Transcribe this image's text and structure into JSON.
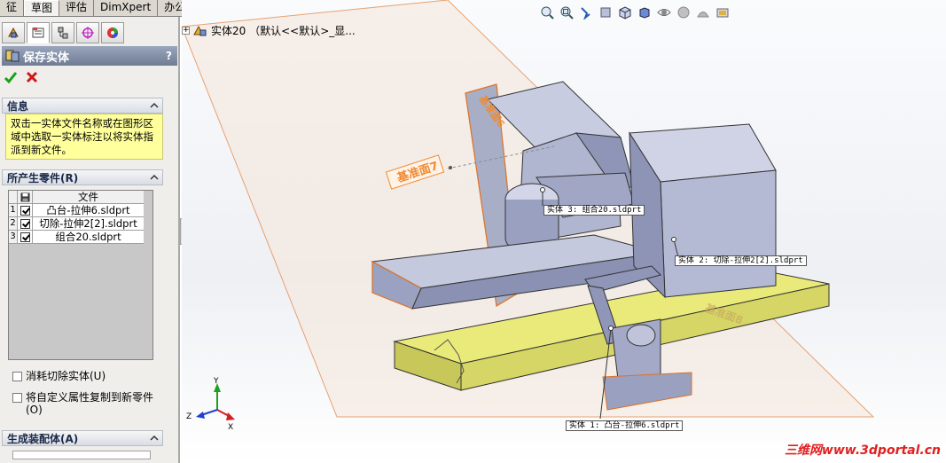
{
  "top_tabs": [
    "征",
    "草图",
    "评估",
    "DimXpert",
    "办公室产品"
  ],
  "active_top_tab": "草图",
  "manager_tabs": [
    "feature-manager-icon",
    "property-manager-icon",
    "configuration-manager-icon",
    "dimxpert-manager-icon",
    "display-manager-icon"
  ],
  "property_manager": {
    "title": "保存实体",
    "help": "?",
    "ok_icon": "green-check-icon",
    "cancel_icon": "red-x-icon"
  },
  "info_group": {
    "title": "信息",
    "text": "双击一实体文件名称或在图形区域中选取一实体标注以将实体指派到新文件。"
  },
  "parts_group": {
    "title": "所产生零件(R)",
    "column_header": "文件",
    "rows": [
      {
        "num": "1",
        "checked": true,
        "name": "凸台-拉伸6.sldprt"
      },
      {
        "num": "2",
        "checked": true,
        "name": "切除-拉伸2[2].sldprt"
      },
      {
        "num": "3",
        "checked": true,
        "name": "组合20.sldprt"
      }
    ],
    "option_consume": "消耗切除实体(U)",
    "option_copy": "将自定义属性复制到新零件(O)"
  },
  "assembly_group": {
    "title": "生成装配体(A)"
  },
  "graphics": {
    "tree_node": "实体20 （默认<<默认>_显...",
    "callouts": [
      {
        "label": "实体  3:  组合20.sldprt"
      },
      {
        "label": "实体  2:  切除-拉伸2[2].sldprt"
      },
      {
        "label": "实体  1:  凸台-拉伸6.sldprt"
      }
    ],
    "plane_label_1": "基准面7",
    "plane_label_2": "基准面6",
    "plane_label_3": "基准面8",
    "triad_x": "X",
    "triad_y": "Y",
    "triad_z": "Z",
    "watermark": "三维网www.3dportal.cn"
  },
  "colors": {
    "part_face": "#b8bdd6",
    "part_dark": "#6f7699",
    "base_yellow": "#eaea7a",
    "plane_orange": "#f08a30",
    "watermark_red": "#e02020"
  }
}
